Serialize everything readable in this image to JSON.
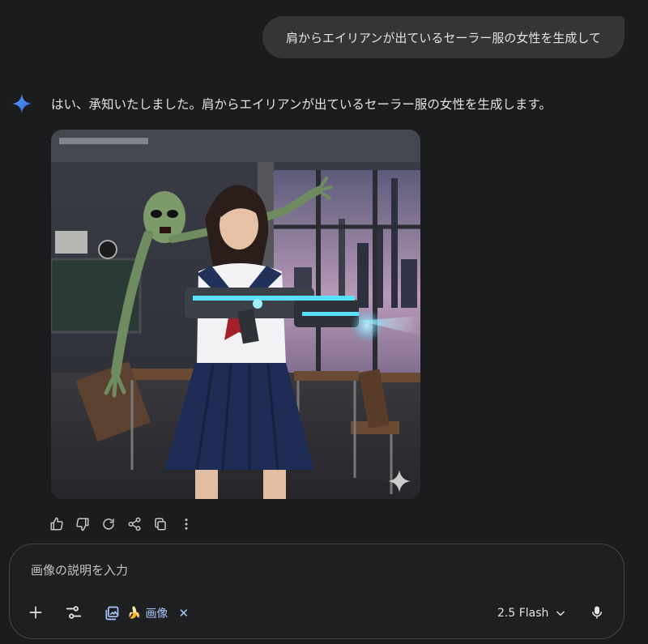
{
  "user_message": {
    "text": "肩からエイリアンが出ているセーラー服の女性を生成して"
  },
  "response": {
    "text": "はい、承知いたしました。肩からエイリアンが出ているセーラー服の女性を生成します。"
  },
  "actions": [
    {
      "name": "thumb-up-icon"
    },
    {
      "name": "thumb-down-icon"
    },
    {
      "name": "regenerate-icon"
    },
    {
      "name": "share-icon"
    },
    {
      "name": "copy-icon"
    },
    {
      "name": "more-vert-icon"
    }
  ],
  "composer": {
    "placeholder": "画像の説明を入力",
    "tool_chip": {
      "emoji": "🍌",
      "label": "画像",
      "close": "✕"
    },
    "model_label": "2.5 Flash"
  },
  "colors": {
    "background": "#1b1c1d",
    "bubble": "#333537",
    "accent_blue": "#a8c7fa",
    "spark_blue": "#4285f4"
  }
}
